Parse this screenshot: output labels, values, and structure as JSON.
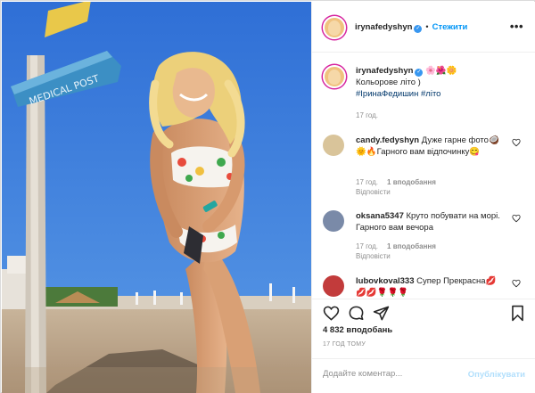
{
  "post": {
    "username": "irynafedyshyn",
    "follow_label": "Стежити",
    "separator": "•",
    "more_icon": "•••",
    "photo_sign_text": "MEDICAL POST"
  },
  "caption": {
    "username": "irynafedyshyn",
    "emoji": "🌸🌺🌼",
    "text": "Кольорове літо )",
    "hashtags": "#ІринаФедишин #літо",
    "time": "17 год."
  },
  "comments": [
    {
      "username": "candy.fedyshyn",
      "text": "Дуже гарне фото🥥🌞🔥Гарного вам відпочинку😋",
      "time": "17 год.",
      "likes": "1 вподобання",
      "reply": "Відповісти"
    },
    {
      "username": "oksana5347",
      "text": "Круто побувати на морі. Гарного вам вечора",
      "time": "17 год.",
      "likes": "1 вподобання",
      "reply": "Відповісти"
    },
    {
      "username": "lubovkoval333",
      "text": "Супер Прекрасна💋💋💋🌹🌹🌹",
      "time": "",
      "likes": "",
      "reply": ""
    }
  ],
  "actions": {
    "likes_count": "4 832 вподобань",
    "time_ago": "17 ГОД ТОМУ"
  },
  "comment_box": {
    "placeholder": "Додайте коментар...",
    "publish_label": "Опублікувати"
  },
  "colors": {
    "accent": "#0095f6",
    "publish_disabled": "#b2dffc",
    "muted": "#8e8e8e",
    "hashtag": "#00376b"
  }
}
